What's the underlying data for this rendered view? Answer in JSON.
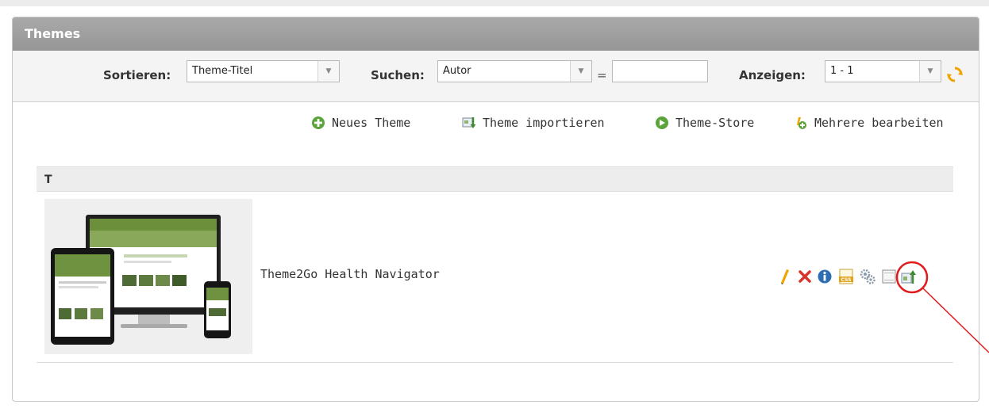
{
  "panel": {
    "title": "Themes"
  },
  "toolbar": {
    "sort_label": "Sortieren:",
    "sort_value": "Theme-Titel",
    "search_label": "Suchen:",
    "search_field_value": "Autor",
    "equals": "=",
    "search_value": "",
    "show_label": "Anzeigen:",
    "show_value": "1 - 1",
    "refresh_icon": "refresh-icon"
  },
  "actions": {
    "new_theme": "Neues Theme",
    "import_theme": "Theme importieren",
    "theme_store": "Theme-Store",
    "edit_multiple": "Mehrere bearbeiten"
  },
  "group": {
    "letter": "T"
  },
  "themes": [
    {
      "name": "Theme2Go Health Navigator",
      "row_icons": [
        "edit-pencil-icon",
        "delete-x-icon",
        "info-icon",
        "css-icon",
        "settings-gears-icon",
        "layout-icon",
        "upload-icon"
      ]
    }
  ],
  "colors": {
    "header": "#9e9e9e",
    "accent_green": "#5aa43a",
    "delete_red": "#d9362b",
    "info_blue": "#2c6db3",
    "annotation_red": "#e11b1b"
  }
}
